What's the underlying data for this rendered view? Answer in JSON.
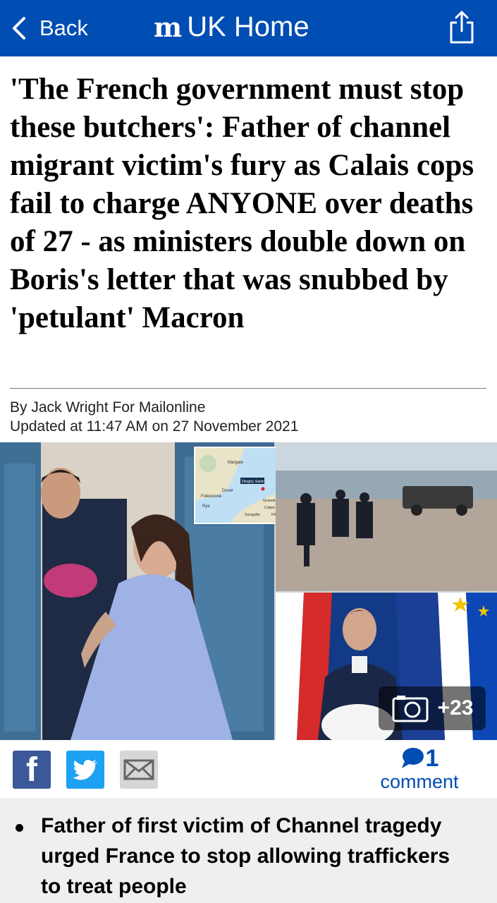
{
  "topbar": {
    "back_label": "Back",
    "logo_text": "m",
    "section_title": "UK Home",
    "bg_color": "#004db3"
  },
  "article": {
    "headline": "'The French government must stop these butchers': Father of channel migrant victim's fury as Calais cops fail to charge ANYONE over deaths of 27 - as ministers double down on Boris's letter that was snubbed by 'petulant' Macron",
    "byline": "By Jack Wright For Mailonline",
    "updated": "Updated at 11:47 AM on 27 November 2021"
  },
  "gallery": {
    "count_label": "+23",
    "map_labels": [
      "Margate",
      "Dinghy Sank",
      "Folkestone",
      "Dover",
      "Rye",
      "Gravelines",
      "Calais",
      "Sangatte",
      "FRANCE"
    ]
  },
  "share": {
    "facebook_icon": "f",
    "comment_count": "1",
    "comment_label": "comment"
  },
  "bullets": [
    "Father of first victim of Channel tragedy urged France to stop allowing traffickers to treat people"
  ]
}
